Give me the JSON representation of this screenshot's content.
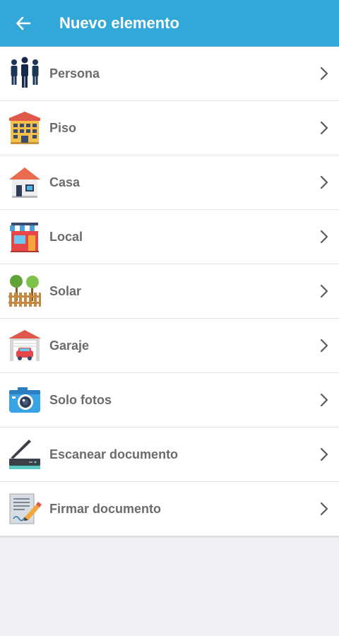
{
  "header": {
    "title": "Nuevo elemento",
    "back_icon": "arrow-left-icon"
  },
  "items": [
    {
      "label": "Persona",
      "icon": "people-icon"
    },
    {
      "label": "Piso",
      "icon": "apartment-building-icon"
    },
    {
      "label": "Casa",
      "icon": "house-icon"
    },
    {
      "label": "Local",
      "icon": "shop-icon"
    },
    {
      "label": "Solar",
      "icon": "trees-fence-icon"
    },
    {
      "label": "Garaje",
      "icon": "garage-car-icon"
    },
    {
      "label": "Solo fotos",
      "icon": "camera-icon"
    },
    {
      "label": "Escanear documento",
      "icon": "scanner-icon"
    },
    {
      "label": "Firmar documento",
      "icon": "sign-document-icon"
    }
  ],
  "colors": {
    "appbar": "#33a8d8",
    "background": "#efeff4",
    "label": "#6b6b6b"
  }
}
